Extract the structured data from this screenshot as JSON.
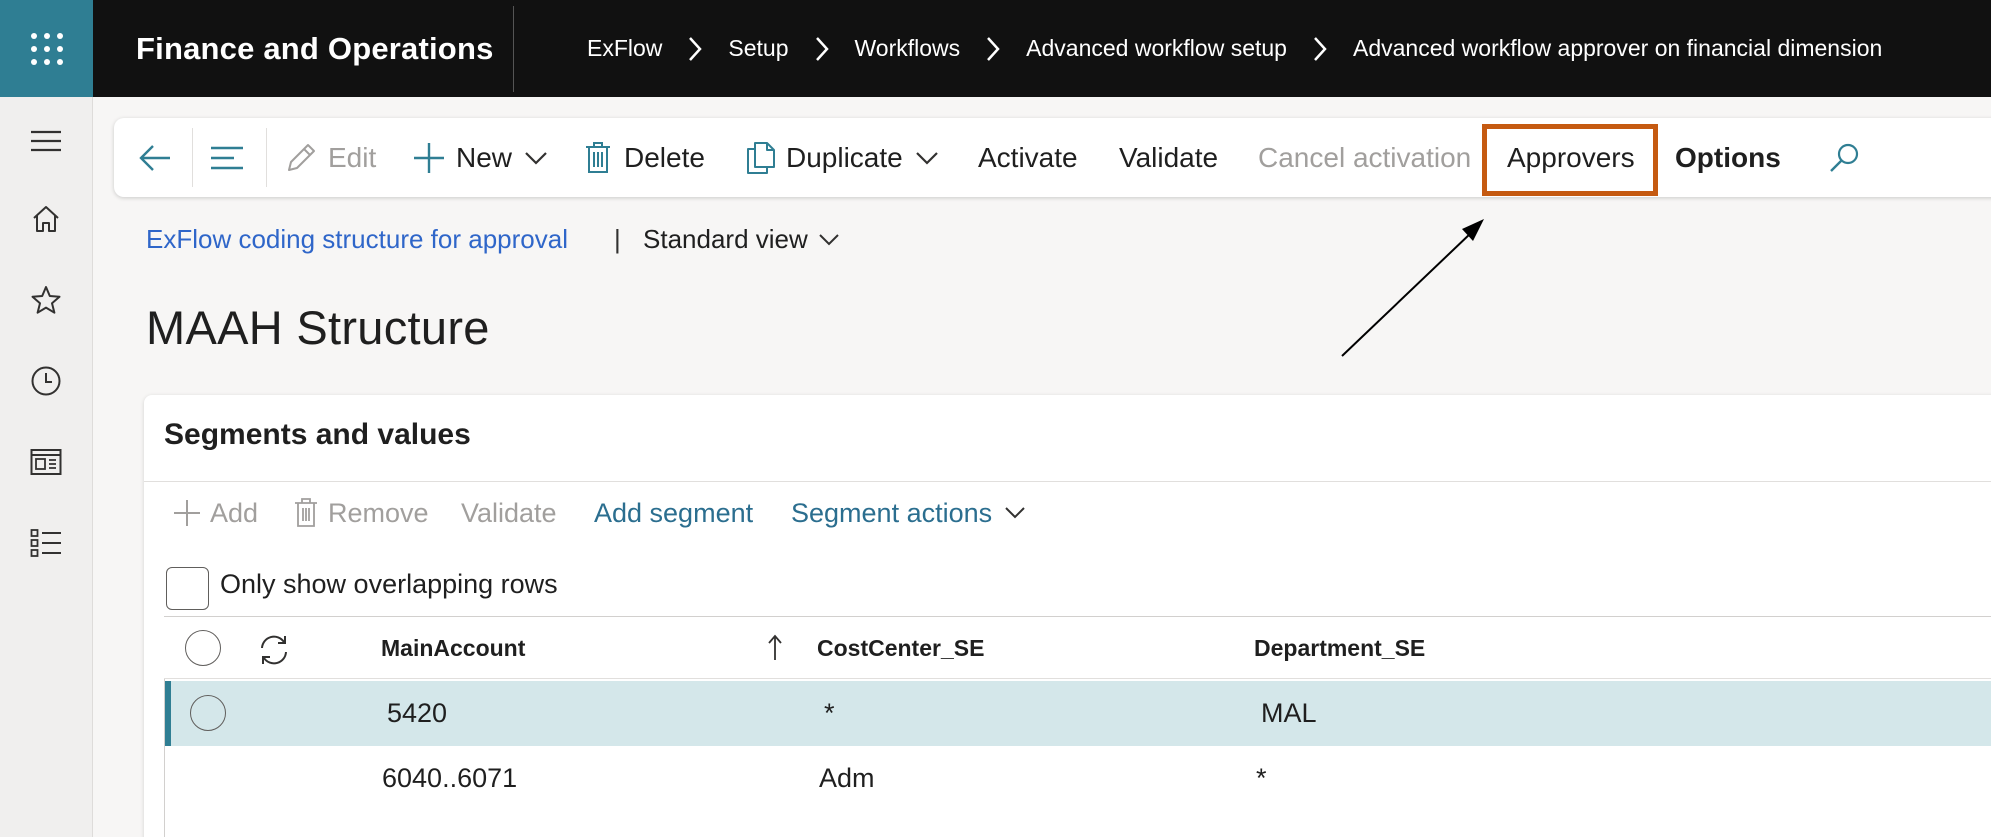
{
  "header": {
    "app_title": "Finance and Operations",
    "breadcrumb": [
      "ExFlow",
      "Setup",
      "Workflows",
      "Advanced workflow setup",
      "Advanced workflow approver on financial dimension"
    ]
  },
  "actions": {
    "edit": "Edit",
    "new": "New",
    "delete": "Delete",
    "duplicate": "Duplicate",
    "activate": "Activate",
    "validate": "Validate",
    "cancel_activation": "Cancel activation",
    "approvers": "Approvers",
    "options": "Options"
  },
  "page": {
    "link": "ExFlow coding structure for approval",
    "separator": "|",
    "view": "Standard view",
    "title": "MAAH Structure"
  },
  "section": {
    "title": "Segments and values",
    "toolbar": {
      "add": "Add",
      "remove": "Remove",
      "validate": "Validate",
      "add_segment": "Add segment",
      "segment_actions": "Segment actions"
    },
    "only_overlapping_label": "Only show overlapping rows",
    "only_overlapping_checked": false
  },
  "grid": {
    "columns": [
      "MainAccount",
      "CostCenter_SE",
      "Department_SE"
    ],
    "rows": [
      {
        "main_account": "5420",
        "cost_center": "*",
        "department": "MAL",
        "selected": true
      },
      {
        "main_account": "6040..6071",
        "cost_center": "Adm",
        "department": "*",
        "selected": false
      }
    ]
  },
  "colors": {
    "header_bg": "#111111",
    "waffle_bg": "#2f7e93",
    "highlight_border": "#c55a11",
    "selected_row": "#d4e7ea",
    "link": "#2f66c9"
  }
}
